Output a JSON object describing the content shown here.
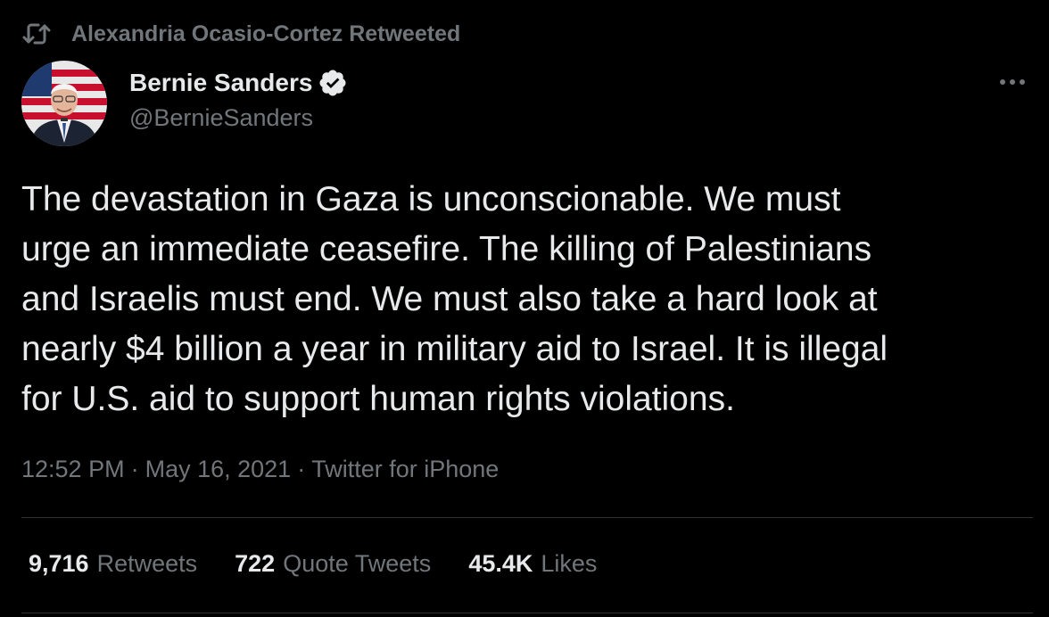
{
  "retweet_context": {
    "icon": "retweet-icon",
    "text": "Alexandria Ocasio-Cortez Retweeted"
  },
  "author": {
    "name": "Bernie Sanders",
    "handle": "@BernieSanders",
    "verified_icon": "verified-badge-icon",
    "avatar_icon": "avatar"
  },
  "menu_icon": "more-options-icon",
  "tweet": {
    "text": "The devastation in Gaza is unconscionable. We must\nurge an immediate ceasefire. The killing of Palestinians\nand Israelis must end. We must also take a hard look at\nnearly $4 billion a year in military aid to Israel. It is illegal\nfor U.S. aid to support human rights violations."
  },
  "meta": {
    "time": "12:52 PM",
    "date": "May 16, 2021",
    "source": "Twitter for iPhone",
    "separator": "·"
  },
  "stats": {
    "retweets": {
      "count": "9,716",
      "label": "Retweets"
    },
    "quote_tweets": {
      "count": "722",
      "label": "Quote Tweets"
    },
    "likes": {
      "count": "45.4K",
      "label": "Likes"
    }
  },
  "colors": {
    "background": "#000000",
    "primary_text": "#e7e9ea",
    "secondary_text": "#71767b",
    "divider": "#2f3336"
  }
}
